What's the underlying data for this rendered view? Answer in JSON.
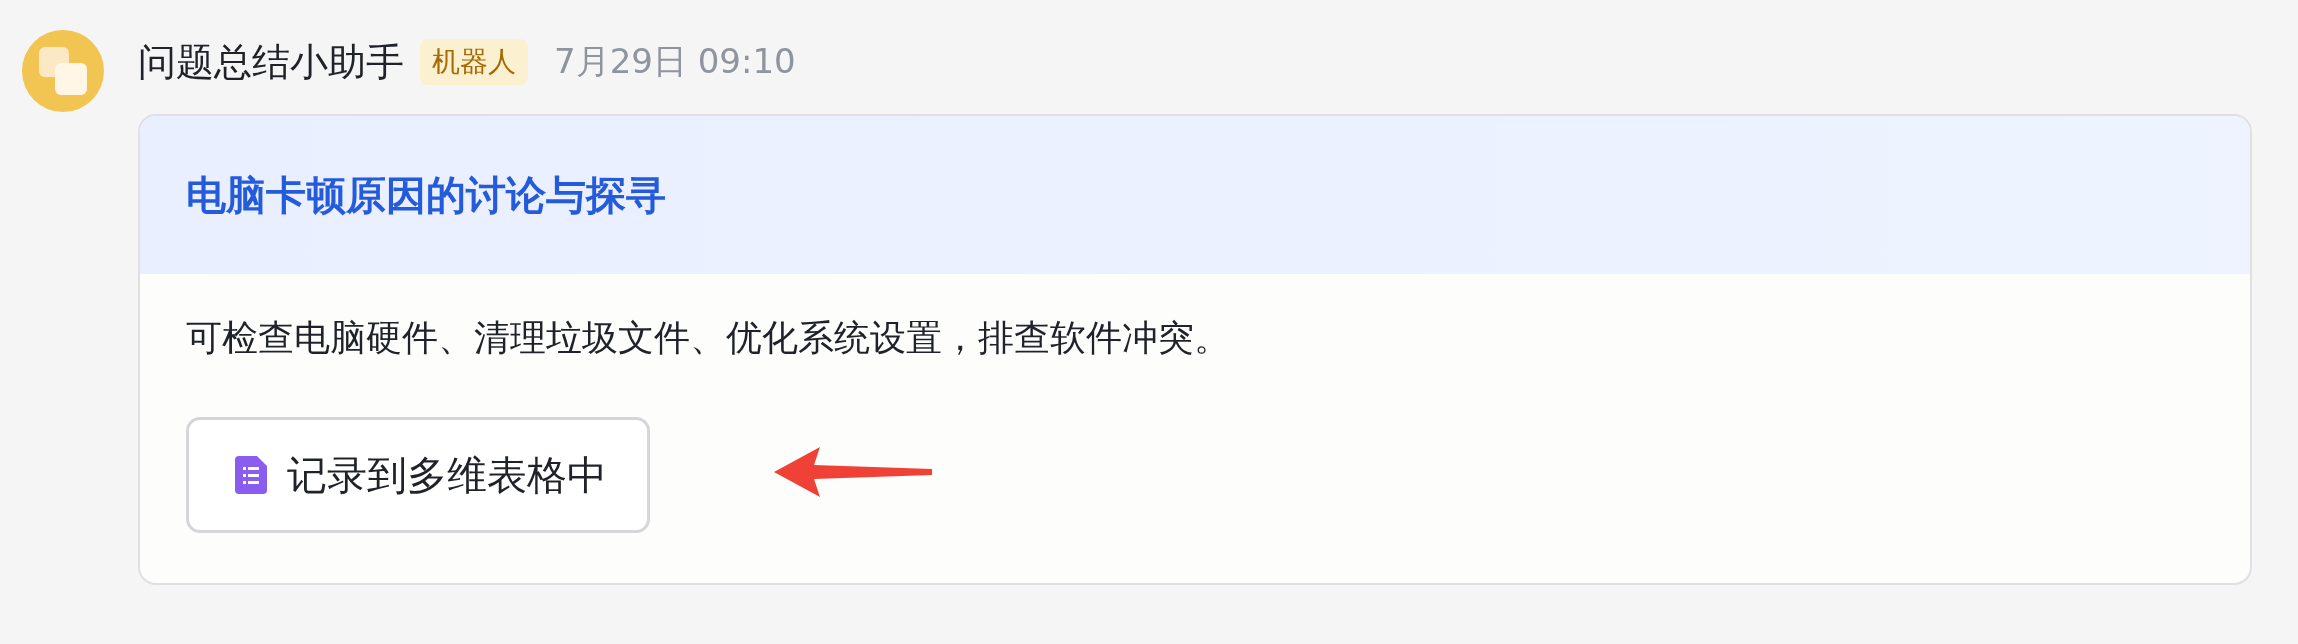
{
  "message": {
    "sender": "问题总结小助手",
    "badge": "机器人",
    "time": "7月29日 09:10"
  },
  "card": {
    "title": "电脑卡顿原因的讨论与探寻",
    "body": "可检查电脑硬件、清理垃圾文件、优化系统设置，排查软件冲突。",
    "button": "记录到多维表格中"
  }
}
